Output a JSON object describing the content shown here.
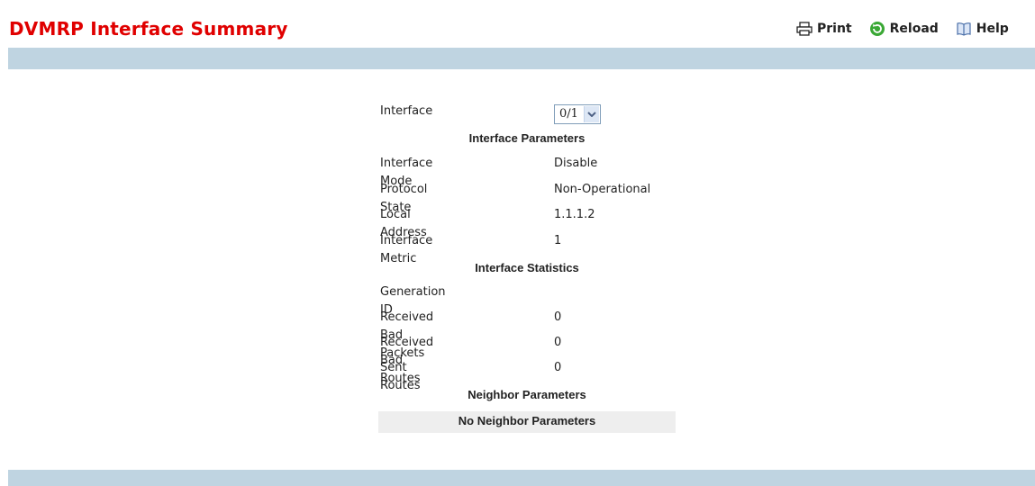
{
  "page": {
    "title": "DVMRP Interface Summary"
  },
  "toolbar": {
    "print": "Print",
    "reload": "Reload",
    "help": "Help"
  },
  "interface": {
    "label": "Interface",
    "selected": "0/1"
  },
  "sections": {
    "params": "Interface Parameters",
    "stats": "Interface Statistics",
    "neighbor": "Neighbor Parameters"
  },
  "params": [
    {
      "label": "Interface Mode",
      "value": "Disable"
    },
    {
      "label": "Protocol State",
      "value": "Non-Operational"
    },
    {
      "label": "Local Address",
      "value": "1.1.1.2"
    },
    {
      "label": "Interface Metric",
      "value": "1"
    }
  ],
  "stats": [
    {
      "label": "Generation ID",
      "value": ""
    },
    {
      "label": "Received Bad Packets",
      "value": "0"
    },
    {
      "label": "Received Bad Routes",
      "value": "0"
    },
    {
      "label": "Sent Routes",
      "value": "0"
    }
  ],
  "neighbor": {
    "empty_text": "No Neighbor Parameters"
  }
}
